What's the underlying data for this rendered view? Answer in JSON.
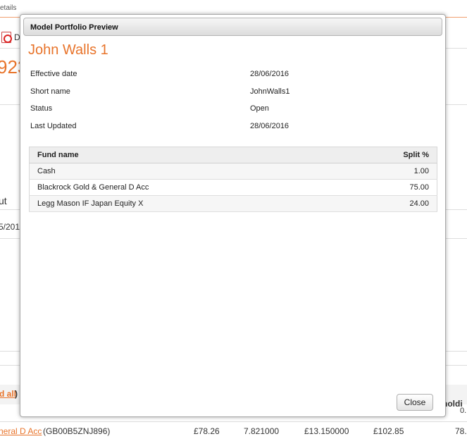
{
  "background": {
    "crumb": "etails",
    "pdf_label": "D",
    "big_number": "923",
    "ut_text": "ut",
    "date_text": "5/201",
    "link_all": "d all",
    "link_all_paren": ")",
    "holdi_text": "f holdi",
    "zero_text": "0.",
    "row": {
      "fund_link": "neral D Acc",
      "isin": "(GB00B5ZNJ896)",
      "c1": "£78.26",
      "c2": "7.821000",
      "c3": "£13.150000",
      "c4": "£102.85",
      "c5": "78."
    }
  },
  "modal": {
    "title": "Model Portfolio Preview",
    "portfolio_name": "John Walls 1",
    "details": [
      {
        "label": "Effective date",
        "value": "28/06/2016"
      },
      {
        "label": "Short name",
        "value": "JohnWalls1"
      },
      {
        "label": "Status",
        "value": "Open"
      },
      {
        "label": "Last Updated",
        "value": "28/06/2016"
      }
    ],
    "table": {
      "headers": {
        "fund": "Fund name",
        "split": "Split %"
      },
      "rows": [
        {
          "fund": "Cash",
          "split": "1.00"
        },
        {
          "fund": "Blackrock Gold & General D Acc",
          "split": "75.00"
        },
        {
          "fund": "Legg Mason IF Japan Equity X",
          "split": "24.00"
        }
      ]
    },
    "close_label": "Close"
  },
  "colors": {
    "accent": "#e8742b"
  }
}
